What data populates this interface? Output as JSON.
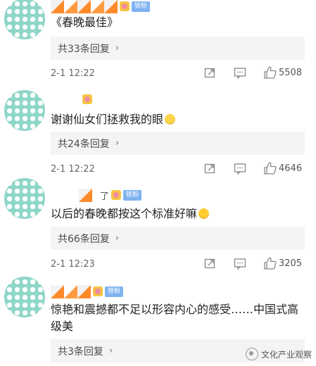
{
  "comments": [
    {
      "username_suffix": "",
      "fan_badge": "铁粉",
      "text": "《春晚最佳》",
      "emoji": "",
      "reply_label": "共33条回复",
      "time": "2-1 12:22",
      "likes": "5508"
    },
    {
      "username_suffix": "",
      "fan_badge": "",
      "text": "谢谢仙女们拯救我的眼",
      "emoji": "smile-emoji",
      "reply_label": "共24条回复",
      "time": "2-1 12:22",
      "likes": "4646"
    },
    {
      "username_suffix": "了",
      "fan_badge": "铁粉",
      "text": "以后的春晚都按这个标准好嘛",
      "emoji": "cry-emoji",
      "reply_label": "共66条回复",
      "time": "2-1 12:23",
      "likes": "3205"
    },
    {
      "username_suffix": "",
      "fan_badge": "铁粉",
      "text": "惊艳和震撼都不足以形容内心的感受……中国式高级美",
      "emoji": "",
      "reply_label": "共3条回复",
      "time": "",
      "likes": ""
    }
  ],
  "watermark": "文化产业观察",
  "colors": {
    "avatar": "#8fd6c8",
    "reply_bg": "#f4f4f4",
    "fan_badge": "#7fb3f0",
    "tile_accent": "#ff8a2a"
  }
}
